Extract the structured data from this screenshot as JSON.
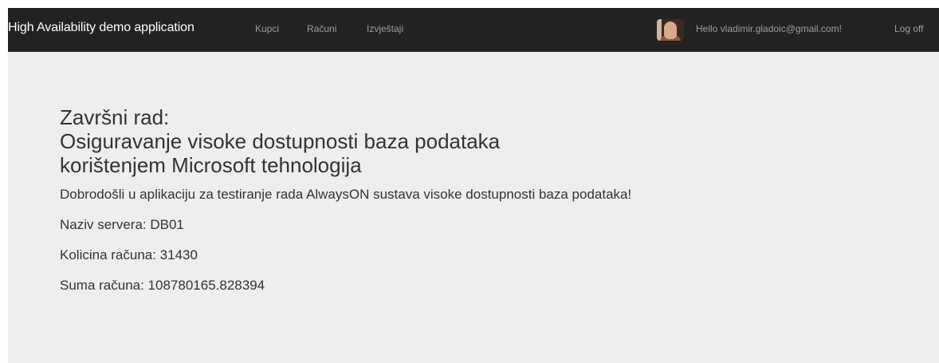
{
  "navbar": {
    "brand": "High Availability demo application",
    "links": [
      "Kupci",
      "Računi",
      "Izvještaji"
    ],
    "greeting": "Hello vladimir.gladoic@gmail.com!",
    "logoff": "Log off"
  },
  "main": {
    "title_lines": [
      "Završni rad:",
      "Osiguravanje visoke dostupnosti baza podataka",
      "korištenjem Microsoft tehnologija"
    ],
    "lead": "Dobrodošli u aplikaciju za testiranje rada AlwaysON sustava visoke dostupnosti baza podataka!",
    "server_name": "Naziv servera: DB01",
    "invoice_count": "Kolicina računa: 31430",
    "invoice_sum": "Suma računa: 108780165.828394"
  },
  "colors": {
    "navbar_bg": "#222222",
    "nav_text": "#9d9d9d",
    "brand_text": "#ffffff",
    "content_bg": "#eeeeee",
    "body_text": "#333333"
  },
  "icons": {
    "avatar": "user-avatar-photo"
  }
}
